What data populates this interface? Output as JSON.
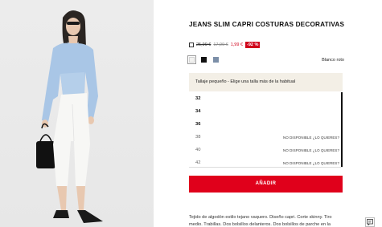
{
  "product": {
    "title": "JEANS SLIM CAPRI COSTURAS DECORATIVAS",
    "price_original": "25,99 €",
    "price_previous": "17,99 €",
    "price_current": "1,99 €",
    "discount": "-92 %"
  },
  "colors": {
    "selected_name": "Blanco roto",
    "swatches": [
      {
        "name": "blanco-roto",
        "hex": "#f2f2f0"
      },
      {
        "name": "negro",
        "hex": "#111111"
      },
      {
        "name": "azul",
        "hex": "#7c8fa8"
      }
    ]
  },
  "size_hint": "Tallaje pequeño - Elige una talla más de la habitual",
  "sizes": [
    {
      "label": "32",
      "status": ""
    },
    {
      "label": "34",
      "status": ""
    },
    {
      "label": "36",
      "status": ""
    },
    {
      "label": "38",
      "status": "NO DISPONIBLE ¿LO QUIERES?"
    },
    {
      "label": "40",
      "status": "NO DISPONIBLE ¿LO QUIERES?"
    },
    {
      "label": "42",
      "status": "NO DISPONIBLE ¿LO QUIERES?"
    }
  ],
  "add_button": "AÑADIR",
  "description": "Tejido de algodón estilo tejano vaquero. Diseño capri. Corte skinny. Tiro medio. Trabillas. Dos bolsillos delanteros. Dos bolsillos de parche en la",
  "theme": {
    "accent": "#e0001b",
    "hint_bg": "#f3efe6"
  }
}
